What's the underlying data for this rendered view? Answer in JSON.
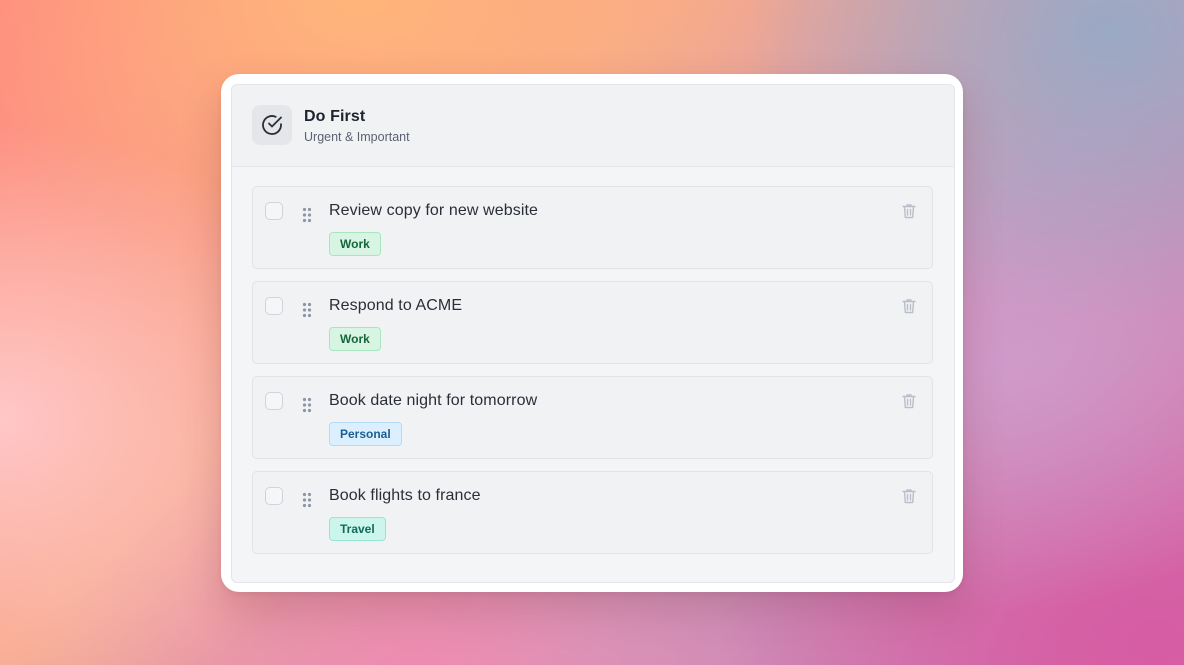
{
  "quadrant": {
    "title": "Do First",
    "subtitle": "Urgent & Important",
    "icon": "check-circle-icon"
  },
  "tasks": [
    {
      "title": "Review copy for new website",
      "tag": "Work",
      "tag_type": "work",
      "completed": false
    },
    {
      "title": "Respond to ACME",
      "tag": "Work",
      "tag_type": "work",
      "completed": false
    },
    {
      "title": "Book date night for tomorrow",
      "tag": "Personal",
      "tag_type": "personal",
      "completed": false
    },
    {
      "title": "Book flights to france",
      "tag": "Travel",
      "tag_type": "travel",
      "completed": false
    }
  ],
  "icons": {
    "drag": "drag-handle-icon",
    "delete": "trash-icon",
    "checkbox": "checkbox"
  },
  "colors": {
    "work_tag_bg": "#d8f5e3",
    "work_tag_text": "#16663d",
    "personal_tag_bg": "#dcefff",
    "personal_tag_text": "#1b5f92",
    "travel_tag_bg": "#ccf5ec",
    "travel_tag_text": "#0f6b5a"
  }
}
